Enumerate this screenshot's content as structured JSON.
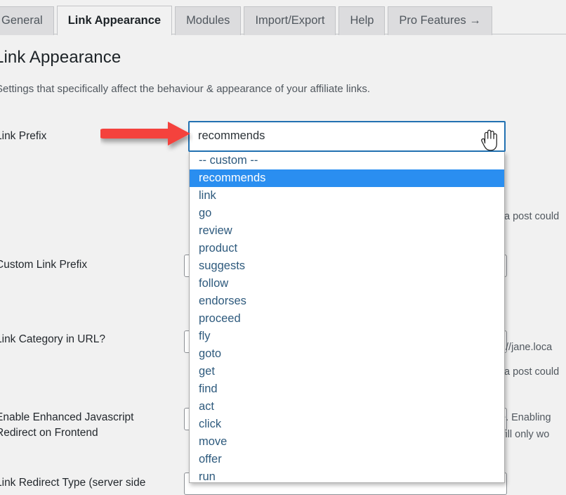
{
  "tabs": [
    {
      "label": "General",
      "active": false
    },
    {
      "label": "Link Appearance",
      "active": true
    },
    {
      "label": "Modules",
      "active": false
    },
    {
      "label": "Import/Export",
      "active": false
    },
    {
      "label": "Help",
      "active": false
    },
    {
      "label": "Pro Features →",
      "active": false
    }
  ],
  "page": {
    "title": "Link Appearance",
    "subtitle": "Settings that specifically affect the behaviour & appearance of your affiliate links."
  },
  "fields": {
    "link_prefix_label": "Link Prefix",
    "custom_link_prefix_label": "Custom Link Prefix",
    "link_category_label": "Link Category in URL?",
    "enhanced_js_label": "Enable Enhanced Javascript\nRedirect on Frontend",
    "redirect_type_label": "Link Redirect Type (server side"
  },
  "descriptions": {
    "prefix_fragment": "a post could",
    "category_fragment_url": "://jane.loca",
    "category_fragment_post": "a post could",
    "js_fragment_1": "e. Enabling",
    "js_fragment_2": "will only wo"
  },
  "select": {
    "value": "recommends",
    "expanded": true,
    "selected_index": 1,
    "focus_color": "#2271b1",
    "highlight_color": "#2a8ef0",
    "option_text_color": "#2e5a7d",
    "options": [
      "-- custom --",
      "recommends",
      "link",
      "go",
      "review",
      "product",
      "suggests",
      "follow",
      "endorses",
      "proceed",
      "fly",
      "goto",
      "get",
      "find",
      "act",
      "click",
      "move",
      "offer",
      "run"
    ]
  },
  "annotations": {
    "arrow_color": "#f4433c",
    "arrow_direction": "right",
    "cursor": "pointing-hand"
  }
}
